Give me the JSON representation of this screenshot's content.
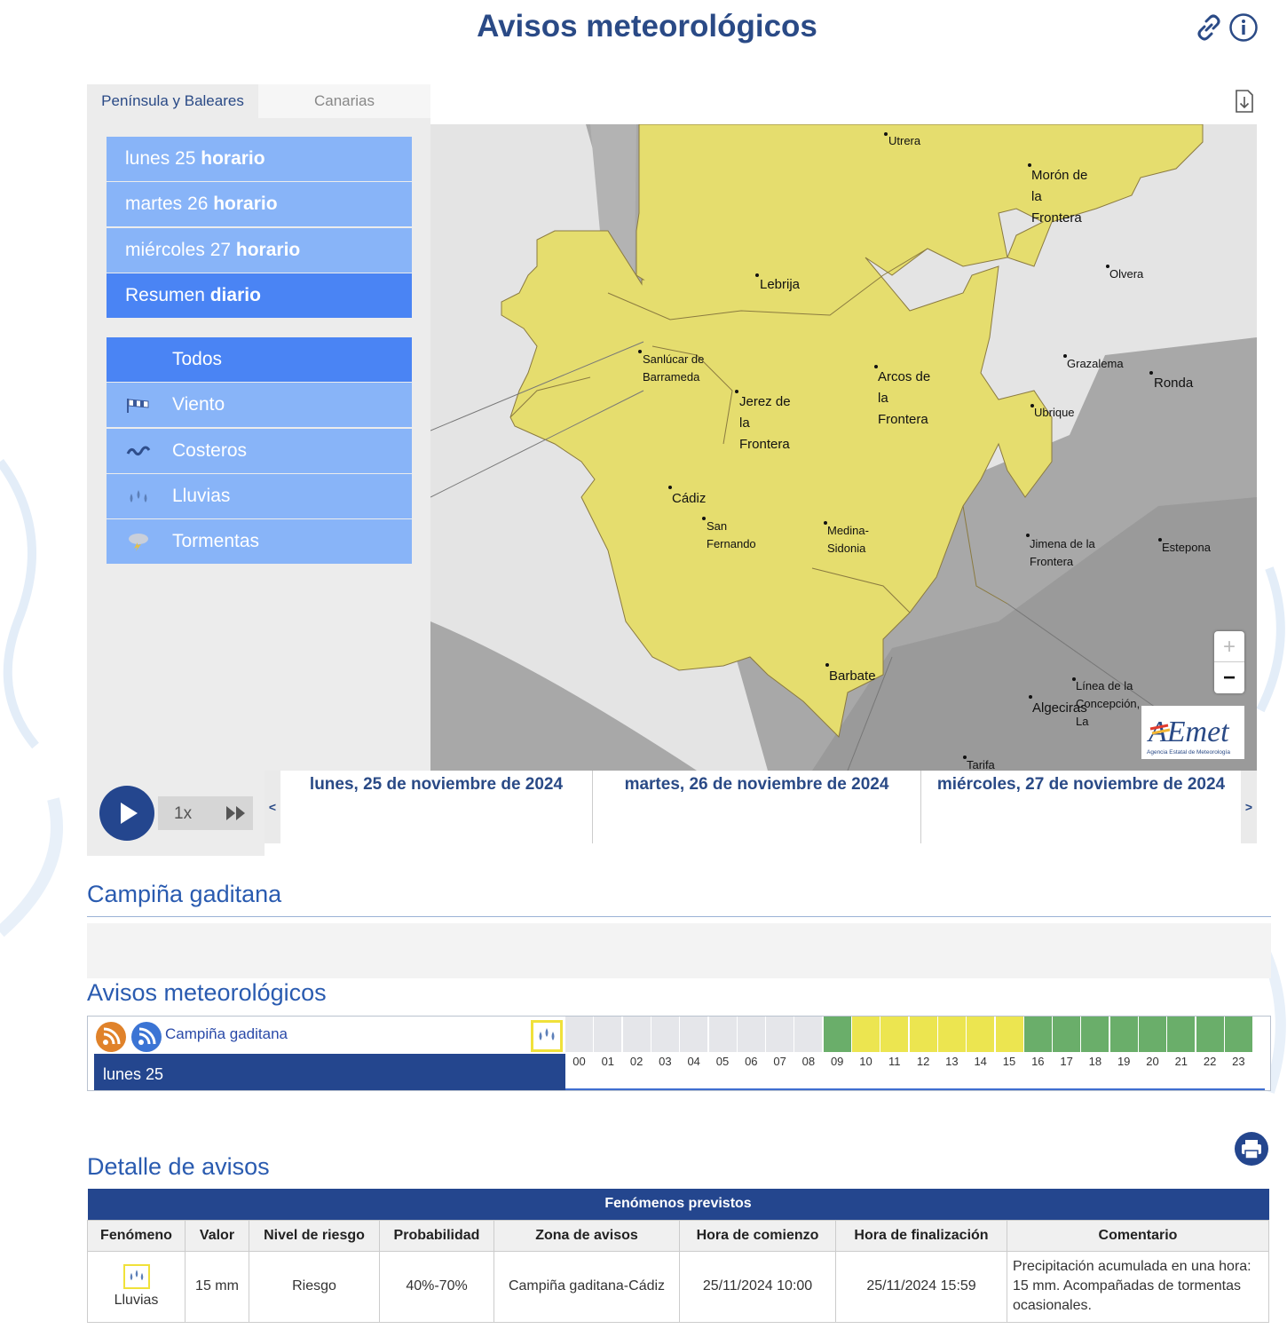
{
  "page": {
    "title": "Avisos meteorológicos"
  },
  "icons": {
    "link": "link-icon",
    "info": "info-icon",
    "download": "download-icon"
  },
  "tabs": {
    "peninsula": "Península y Baleares",
    "canarias": "Canarias"
  },
  "days_menu": [
    {
      "day": "lunes 25",
      "mode": "horario"
    },
    {
      "day": "martes 26",
      "mode": "horario"
    },
    {
      "day": "miércoles 27",
      "mode": "horario"
    },
    {
      "day": "Resumen",
      "mode": "diario"
    }
  ],
  "phenomena_menu": [
    {
      "label": "Todos",
      "icon": ""
    },
    {
      "label": "Viento",
      "icon": "wind-icon"
    },
    {
      "label": "Costeros",
      "icon": "waves-icon"
    },
    {
      "label": "Lluvias",
      "icon": "rain-icon"
    },
    {
      "label": "Tormentas",
      "icon": "storm-icon"
    }
  ],
  "map": {
    "places": [
      "Utrera",
      "Morón de la Frontera",
      "Olvera",
      "Lebrija",
      "Sanlúcar de Barrameda",
      "Jerez de la Frontera",
      "Arcos de la Frontera",
      "Grazalema",
      "Ronda",
      "Ubrique",
      "Cádiz",
      "San Fernando",
      "Medina-Sidonia",
      "Jimena de la Frontera",
      "Estepona",
      "Barbate",
      "Línea de la Concepción, La",
      "Algeciras",
      "Tarifa"
    ],
    "zoom_in": "+",
    "zoom_out": "−",
    "logo_text": "AEmet",
    "logo_sub": "Agencia Estatal de Meteorología",
    "warning_color": "#e5dd6e"
  },
  "player": {
    "speed": "1x"
  },
  "timeline": {
    "prev": "<",
    "next": ">",
    "days": [
      "lunes, 25 de noviembre de 2024",
      "martes, 26 de noviembre de 2024",
      "miércoles, 27 de noviembre de 2024"
    ]
  },
  "zone": {
    "title": "Campiña gaditana"
  },
  "avisos": {
    "title": "Avisos meteorológicos",
    "zone_link": "Campiña gaditana",
    "day_label": "lunes 25",
    "hours": [
      "00",
      "01",
      "02",
      "03",
      "04",
      "05",
      "06",
      "07",
      "08",
      "09",
      "10",
      "11",
      "12",
      "13",
      "14",
      "15",
      "16",
      "17",
      "18",
      "19",
      "20",
      "21",
      "22",
      "23"
    ],
    "levels": [
      "none",
      "none",
      "none",
      "none",
      "none",
      "none",
      "none",
      "none",
      "none",
      "green",
      "yellow",
      "yellow",
      "yellow",
      "yellow",
      "yellow",
      "yellow",
      "green",
      "green",
      "green",
      "green",
      "green",
      "green",
      "green",
      "green"
    ],
    "colors": {
      "none": "#e5e6ea",
      "green": "#6aae6a",
      "yellow": "#ece550"
    }
  },
  "detalle": {
    "title": "Detalle de avisos",
    "caption": "Fenómenos previstos",
    "headers": [
      "Fenómeno",
      "Valor",
      "Nivel de riesgo",
      "Probabilidad",
      "Zona de avisos",
      "Hora de comienzo",
      "Hora de finalización",
      "Comentario"
    ],
    "row": {
      "fenomeno": "Lluvias",
      "valor": "15 mm",
      "nivel": "Riesgo",
      "probabilidad": "40%-70%",
      "zona": "Campiña gaditana-Cádiz",
      "comienzo": "25/11/2024 10:00",
      "fin": "25/11/2024 15:59",
      "comentario": "Precipitación acumulada en una hora: 15 mm. Acompañadas de tormentas ocasionales."
    }
  }
}
